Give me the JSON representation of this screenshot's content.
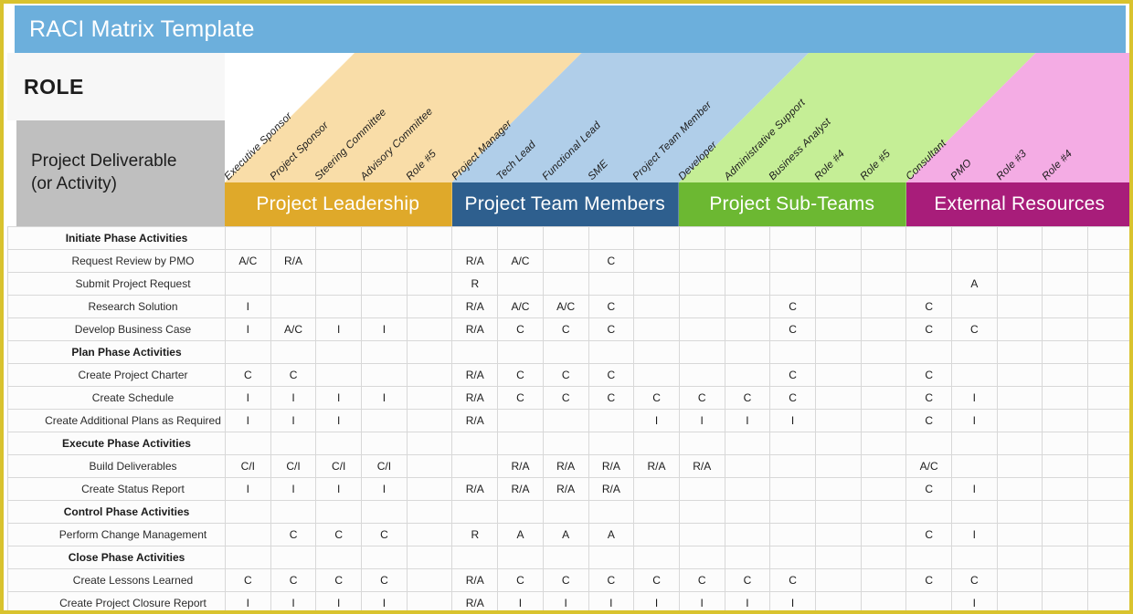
{
  "title": "RACI Matrix Template",
  "role_header": "ROLE",
  "deliverable_header": "Project Deliverable\n(or Activity)",
  "colors": {
    "outer_border": "#d9c32e",
    "titlebar": "#6cafdc",
    "deliverable_bg": "#bfbfbf",
    "leadership_band": "#dfa92a",
    "leadership_diag": "#f9dda8",
    "team_band": "#2e5f8e",
    "team_diag": "#b0cee9",
    "subteam_band": "#6cb832",
    "subteam_diag": "#c5ee96",
    "external_band": "#a81d7a",
    "external_diag": "#f4ace4"
  },
  "groups": [
    {
      "label": "Project Leadership",
      "band_color": "#dfa92a",
      "diag_color": "#f9dda8",
      "columns": 5
    },
    {
      "label": "Project Team Members",
      "band_color": "#2e5f8e",
      "diag_color": "#b0cee9",
      "columns": 5
    },
    {
      "label": "Project Sub-Teams",
      "band_color": "#6cb832",
      "diag_color": "#c5ee96",
      "columns": 5
    },
    {
      "label": "External Resources",
      "band_color": "#a81d7a",
      "diag_color": "#f4ace4",
      "columns": 5
    }
  ],
  "role_columns": [
    "Executive Sponsor",
    "Project Sponsor",
    "Steering Committee",
    "Advisory Committee",
    "Role #5",
    "Project Manager",
    "Tech Lead",
    "Functional Lead",
    "SME",
    "Project Team Member",
    "Developer",
    "Administrative Support",
    "Business Analyst",
    "Role #4",
    "Role #5",
    "Consultant",
    "PMO",
    "Role #3",
    "Role #4",
    ""
  ],
  "rows": [
    {
      "type": "phase",
      "label": "Initiate Phase Activities",
      "values": [
        "",
        "",
        "",
        "",
        "",
        "",
        "",
        "",
        "",
        "",
        "",
        "",
        "",
        "",
        "",
        "",
        "",
        "",
        "",
        ""
      ]
    },
    {
      "type": "activity",
      "label": "Request Review by PMO",
      "values": [
        "A/C",
        "R/A",
        "",
        "",
        "",
        "R/A",
        "A/C",
        "",
        "C",
        "",
        "",
        "",
        "",
        "",
        "",
        "",
        "",
        "",
        "",
        ""
      ]
    },
    {
      "type": "activity",
      "label": "Submit Project Request",
      "values": [
        "",
        "",
        "",
        "",
        "",
        "R",
        "",
        "",
        "",
        "",
        "",
        "",
        "",
        "",
        "",
        "",
        "A",
        "",
        "",
        ""
      ]
    },
    {
      "type": "activity",
      "label": "Research Solution",
      "values": [
        "I",
        "",
        "",
        "",
        "",
        "R/A",
        "A/C",
        "A/C",
        "C",
        "",
        "",
        "",
        "C",
        "",
        "",
        "C",
        "",
        "",
        "",
        ""
      ]
    },
    {
      "type": "activity",
      "label": "Develop Business Case",
      "values": [
        "I",
        "A/C",
        "I",
        "I",
        "",
        "R/A",
        "C",
        "C",
        "C",
        "",
        "",
        "",
        "C",
        "",
        "",
        "C",
        "C",
        "",
        "",
        ""
      ]
    },
    {
      "type": "phase",
      "label": "Plan Phase Activities",
      "values": [
        "",
        "",
        "",
        "",
        "",
        "",
        "",
        "",
        "",
        "",
        "",
        "",
        "",
        "",
        "",
        "",
        "",
        "",
        "",
        ""
      ]
    },
    {
      "type": "activity",
      "label": "Create Project Charter",
      "values": [
        "C",
        "C",
        "",
        "",
        "",
        "R/A",
        "C",
        "C",
        "C",
        "",
        "",
        "",
        "C",
        "",
        "",
        "C",
        "",
        "",
        "",
        ""
      ]
    },
    {
      "type": "activity",
      "label": "Create Schedule",
      "values": [
        "I",
        "I",
        "I",
        "I",
        "",
        "R/A",
        "C",
        "C",
        "C",
        "C",
        "C",
        "C",
        "C",
        "",
        "",
        "C",
        "I",
        "",
        "",
        ""
      ]
    },
    {
      "type": "activity",
      "label": "Create Additional Plans as Required",
      "values": [
        "I",
        "I",
        "I",
        "",
        "",
        "R/A",
        "",
        "",
        "",
        "I",
        "I",
        "I",
        "I",
        "",
        "",
        "C",
        "I",
        "",
        "",
        ""
      ]
    },
    {
      "type": "phase",
      "label": "Execute Phase Activities",
      "values": [
        "",
        "",
        "",
        "",
        "",
        "",
        "",
        "",
        "",
        "",
        "",
        "",
        "",
        "",
        "",
        "",
        "",
        "",
        "",
        ""
      ]
    },
    {
      "type": "activity",
      "label": "Build Deliverables",
      "values": [
        "C/I",
        "C/I",
        "C/I",
        "C/I",
        "",
        "",
        "R/A",
        "R/A",
        "R/A",
        "R/A",
        "R/A",
        "",
        "",
        "",
        "",
        "A/C",
        "",
        "",
        "",
        ""
      ]
    },
    {
      "type": "activity",
      "label": "Create Status Report",
      "values": [
        "I",
        "I",
        "I",
        "I",
        "",
        "R/A",
        "R/A",
        "R/A",
        "R/A",
        "",
        "",
        "",
        "",
        "",
        "",
        "C",
        "I",
        "",
        "",
        ""
      ]
    },
    {
      "type": "phase",
      "label": "Control Phase Activities",
      "values": [
        "",
        "",
        "",
        "",
        "",
        "",
        "",
        "",
        "",
        "",
        "",
        "",
        "",
        "",
        "",
        "",
        "",
        "",
        "",
        ""
      ]
    },
    {
      "type": "activity",
      "label": "Perform Change Management",
      "values": [
        "",
        "C",
        "C",
        "C",
        "",
        "R",
        "A",
        "A",
        "A",
        "",
        "",
        "",
        "",
        "",
        "",
        "C",
        "I",
        "",
        "",
        ""
      ]
    },
    {
      "type": "phase",
      "label": "Close Phase Activities",
      "values": [
        "",
        "",
        "",
        "",
        "",
        "",
        "",
        "",
        "",
        "",
        "",
        "",
        "",
        "",
        "",
        "",
        "",
        "",
        "",
        ""
      ]
    },
    {
      "type": "activity",
      "label": "Create Lessons Learned",
      "values": [
        "C",
        "C",
        "C",
        "C",
        "",
        "R/A",
        "C",
        "C",
        "C",
        "C",
        "C",
        "C",
        "C",
        "",
        "",
        "C",
        "C",
        "",
        "",
        ""
      ]
    },
    {
      "type": "activity",
      "label": "Create Project Closure Report",
      "values": [
        "I",
        "I",
        "I",
        "I",
        "",
        "R/A",
        "I",
        "I",
        "I",
        "I",
        "I",
        "I",
        "I",
        "",
        "",
        "",
        "I",
        "",
        "",
        ""
      ]
    }
  ]
}
